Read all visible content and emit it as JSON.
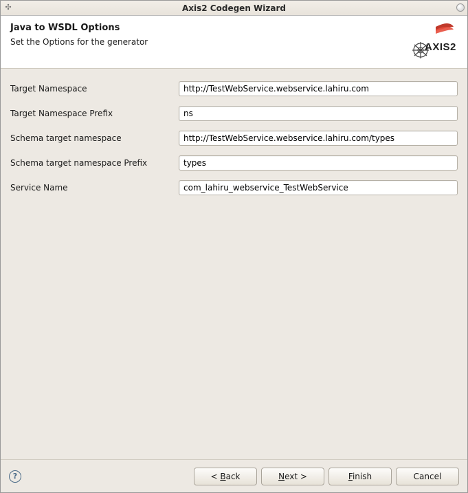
{
  "window": {
    "title": "Axis2 Codegen Wizard"
  },
  "header": {
    "title": "Java to WSDL Options",
    "subtitle": "Set the Options for the generator"
  },
  "form": {
    "target_namespace": {
      "label": "Target Namespace",
      "value": "http://TestWebService.webservice.lahiru.com"
    },
    "target_namespace_prefix": {
      "label": "Target Namespace Prefix",
      "value": "ns"
    },
    "schema_target_namespace": {
      "label": "Schema target namespace",
      "value": "http://TestWebService.webservice.lahiru.com/types"
    },
    "schema_target_namespace_prefix": {
      "label": "Schema target namespace Prefix",
      "value": "types"
    },
    "service_name": {
      "label": "Service Name",
      "value": "com_lahiru_webservice_TestWebService"
    }
  },
  "buttons": {
    "back": "< Back",
    "finish": "Finish",
    "cancel": "Cancel"
  }
}
